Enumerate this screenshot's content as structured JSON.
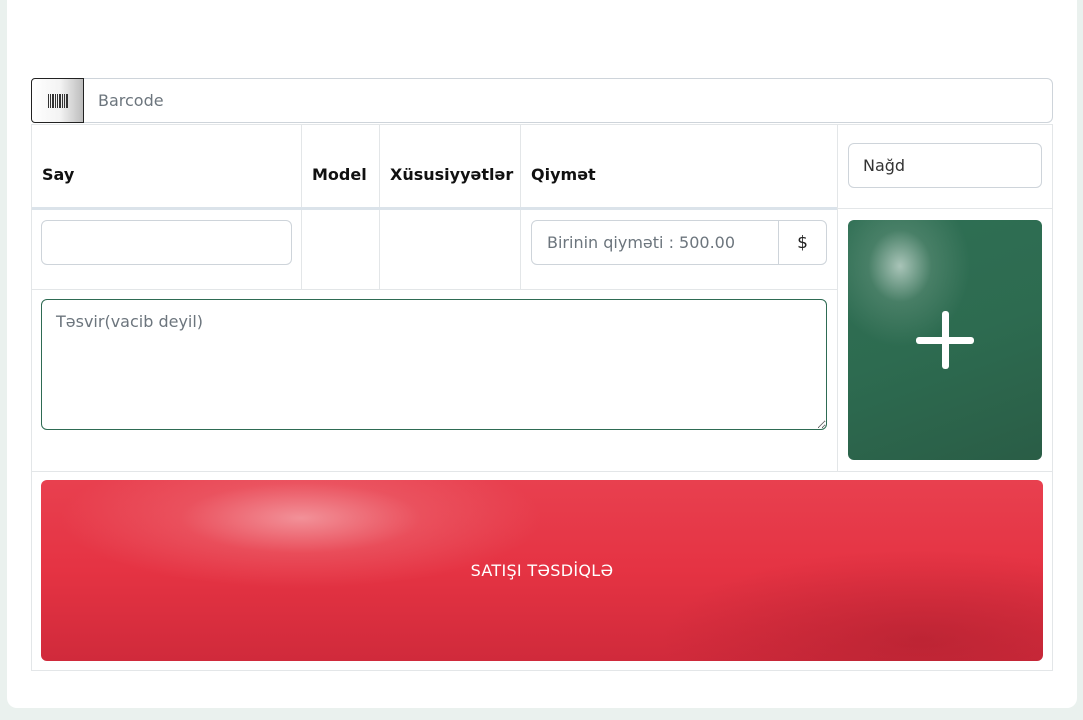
{
  "barcode": {
    "icon": "barcode-icon",
    "placeholder": "Barcode"
  },
  "table": {
    "headers": {
      "say": "Say",
      "model": "Model",
      "features": "Xüsusiyyətlər",
      "price": "Qiymət"
    },
    "payment_select": {
      "selected": "Nağd"
    },
    "row": {
      "quantity_value": "",
      "price_placeholder": "Birinin qiyməti : 500.00",
      "currency": "$"
    },
    "description": {
      "placeholder": "Təsvir(vacib deyil)"
    },
    "add_button": {
      "icon": "plus-icon"
    }
  },
  "confirm": {
    "label": "SATIŞI TƏSDİQLƏ"
  },
  "colors": {
    "add_button": "#2e6b51",
    "confirm_button": "#e53343",
    "textarea_border": "#2e6b53"
  }
}
